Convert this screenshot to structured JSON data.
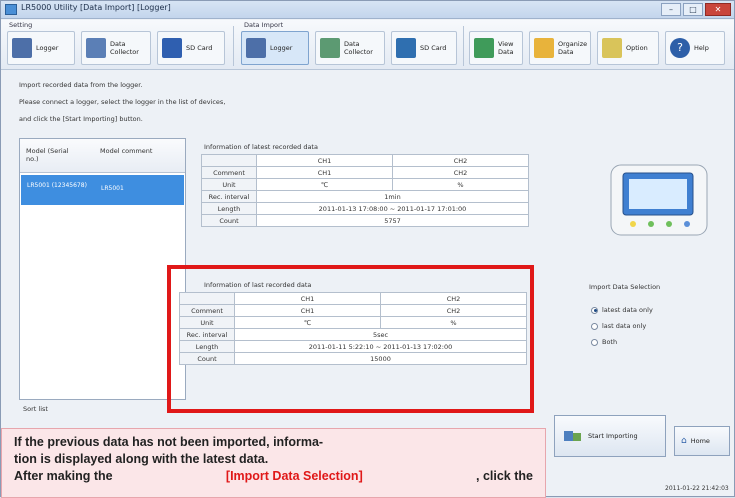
{
  "window": {
    "title": "LR5000 Utility [Data Import] [Logger]"
  },
  "ribbon": {
    "setting_group": "Setting",
    "import_group": "Data Import",
    "setting_buttons": [
      {
        "label": "Logger",
        "icon": "logger-icon"
      },
      {
        "label": "Data Collector",
        "icon": "data-collector-icon"
      },
      {
        "label": "SD Card",
        "icon": "sd-card-icon"
      }
    ],
    "import_buttons": [
      {
        "label": "Logger",
        "icon": "logger-icon"
      },
      {
        "label": "Data Collector",
        "icon": "data-collector-icon"
      },
      {
        "label": "SD Card",
        "icon": "sd-card-icon"
      }
    ],
    "tools": [
      {
        "label": "View Data",
        "icon": "view-data-icon"
      },
      {
        "label": "Organize Data",
        "icon": "folder-icon"
      },
      {
        "label": "Option",
        "icon": "option-icon"
      },
      {
        "label": "Help",
        "icon": "help-icon"
      }
    ]
  },
  "instructions": [
    "Import recorded data from the logger.",
    "Please connect a logger, select the logger in the list of devices,",
    "and click the [Start Importing] button."
  ],
  "device_list": {
    "col_model": "Model (Serial no.)",
    "col_comment": "Model comment",
    "row_model": "LR5001 (12345678)",
    "row_comment": "LR5001",
    "sort_label": "Sort list"
  },
  "latest_info": {
    "title": "Information of latest recorded data",
    "headers": [
      "",
      "CH1",
      "CH2"
    ],
    "rows": [
      {
        "label": "Comment",
        "ch1": "CH1",
        "ch2": "CH2"
      },
      {
        "label": "Unit",
        "ch1": "℃",
        "ch2": "%"
      },
      {
        "label": "Rec. interval",
        "span": "1min"
      },
      {
        "label": "Length",
        "span": "2011-01-13 17:08:00 ~ 2011-01-17 17:01:00"
      },
      {
        "label": "Count",
        "span": "5757"
      }
    ]
  },
  "last_info": {
    "title": "Information of last recorded data",
    "headers": [
      "",
      "CH1",
      "CH2"
    ],
    "rows": [
      {
        "label": "Comment",
        "ch1": "CH1",
        "ch2": "CH2"
      },
      {
        "label": "Unit",
        "ch1": "℃",
        "ch2": "%"
      },
      {
        "label": "Rec. interval",
        "span": "5sec"
      },
      {
        "label": "Length",
        "span": "2011-01-11 5:22:10 ~ 2011-01-13 17:02:00"
      },
      {
        "label": "Count",
        "span": "15000"
      }
    ]
  },
  "import_selection": {
    "title": "Import Data Selection",
    "options": [
      {
        "label": "latest data only",
        "selected": true
      },
      {
        "label": "last data only",
        "selected": false
      },
      {
        "label": "Both",
        "selected": false
      }
    ]
  },
  "buttons": {
    "start": "Start Importing",
    "home": "Home"
  },
  "timestamp": "2011-01-22 21:42:03",
  "callout": {
    "line1": "If the previous data has not been imported, informa-",
    "line2": "tion is displayed along with the latest data.",
    "line3a": "After making the ",
    "line3b": "[Import Data Selection]",
    "line3c": ", click the"
  },
  "colors": {
    "highlight": "#e01818",
    "selection": "#3e8ee0"
  }
}
